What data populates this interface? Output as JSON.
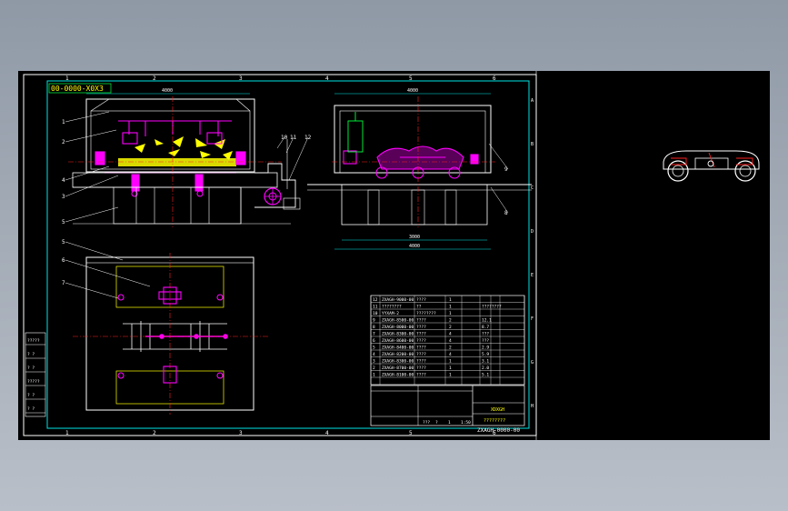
{
  "drawing_number": "00-0000-X0X3",
  "grid": {
    "columns": [
      "1",
      "2",
      "3",
      "4",
      "5",
      "6"
    ],
    "rows": [
      "A",
      "B",
      "C",
      "D",
      "E",
      "F",
      "G",
      "H"
    ]
  },
  "front_view_callouts": [
    "1",
    "2",
    "3",
    "4",
    "5",
    "10",
    "11",
    "12"
  ],
  "side_view_callouts": [
    "9",
    "8"
  ],
  "plan_view_callouts": [
    "5",
    "6",
    "7"
  ],
  "dimensions": {
    "front_top": "4000",
    "side_top": "4000",
    "side_bottom_1": "3000",
    "side_bottom_2": "4000"
  },
  "parts_list": [
    {
      "no": "12",
      "code": "ZXAGH-9000-00",
      "name": "????",
      "qty": "1",
      "note": ""
    },
    {
      "no": "11",
      "code": "????????",
      "name": "??",
      "qty": "1",
      "note": "????????"
    },
    {
      "no": "10",
      "code": "YYXAM-2",
      "name": "????????",
      "qty": "1",
      "note": ""
    },
    {
      "no": "9",
      "code": "ZXAGH-8500-00",
      "name": "????",
      "qty": "2",
      "note": "12.1"
    },
    {
      "no": "8",
      "code": "ZXAGH-8000-00",
      "name": "????",
      "qty": "2",
      "note": "8.7"
    },
    {
      "no": "7",
      "code": "ZXAGH-8300-00",
      "name": "????",
      "qty": "4",
      "note": "???"
    },
    {
      "no": "6",
      "code": "ZXAGH-8600-00",
      "name": "????",
      "qty": "4",
      "note": "???"
    },
    {
      "no": "5",
      "code": "ZXAGH-8400-00",
      "name": "????",
      "qty": "2",
      "note": "2.9"
    },
    {
      "no": "4",
      "code": "ZXAGH-8200-00",
      "name": "????",
      "qty": "4",
      "note": "5.9"
    },
    {
      "no": "3",
      "code": "ZXAGH-8300-00",
      "name": "????",
      "qty": "1",
      "note": "3.1"
    },
    {
      "no": "2",
      "code": "ZXAGH-8700-00",
      "name": "????",
      "qty": "1",
      "note": "2.0"
    },
    {
      "no": "1",
      "code": "ZXAGH-8100-00",
      "name": "????",
      "qty": "1",
      "note": "5.1"
    }
  ],
  "title_block": {
    "company": "XDXGH",
    "drawing_title": "????????",
    "drawing_code": "ZXAGH-0000-00",
    "scale_row": [
      "???",
      "?",
      "1",
      "1:50"
    ]
  },
  "left_strip_labels": [
    "?????",
    "? ?",
    "? ?",
    "?????",
    "? ?",
    "? ?"
  ],
  "colors": {
    "border": "#00e5e5",
    "frame": "#ffffff",
    "magenta": "#ff00ff",
    "yellow": "#ffff00",
    "green": "#00ff40",
    "red": "#ff2020"
  }
}
